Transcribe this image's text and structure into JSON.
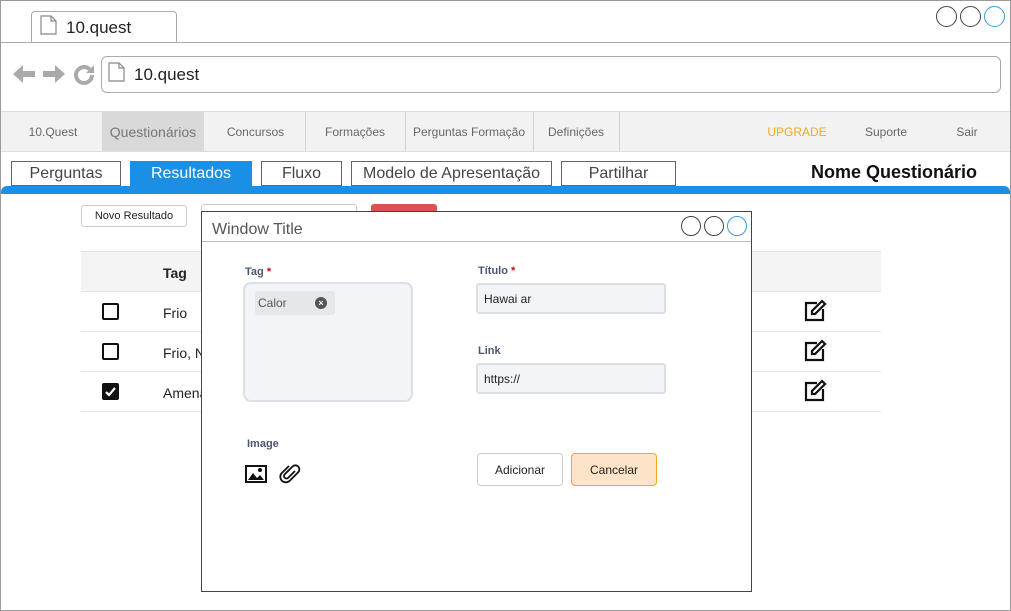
{
  "browser": {
    "tab_title": "10.quest",
    "address": "10.quest"
  },
  "appnav": {
    "items": [
      "10.Quest",
      "Questionários",
      "Concursos",
      "Formações",
      "Perguntas Formação",
      "Definições"
    ],
    "upgrade": "UPGRADE",
    "support": "Suporte",
    "exit": "Sair"
  },
  "subtabs": [
    "Perguntas",
    "Resultados",
    "Fluxo",
    "Modelo de Apresentação",
    "Partilhar"
  ],
  "questionnaire_name": "Nome Questionário",
  "content": {
    "new_result_button": "Novo Resultado",
    "table_header_tag": "Tag",
    "rows": [
      {
        "tag": "Frio",
        "checked": false
      },
      {
        "tag": "Frio, N",
        "checked": false
      },
      {
        "tag": "Amena",
        "checked": true
      }
    ]
  },
  "modal": {
    "title": "Window Title",
    "tag_label": "Tag",
    "tag_chip": "Calor",
    "title_label": "Título",
    "title_value": "Hawai ar",
    "link_label": "Link",
    "link_value": "https://",
    "image_label": "Image",
    "add_button": "Adicionar",
    "cancel_button": "Cancelar",
    "required_mark": "*"
  },
  "colors": {
    "accent_blue": "#1a8fe3",
    "upgrade_orange": "#f5a623",
    "cancel_bg": "#fde3c8"
  }
}
